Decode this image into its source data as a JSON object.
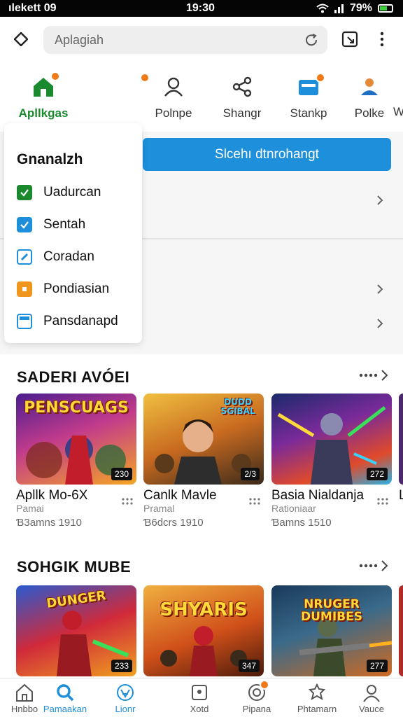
{
  "status_bar": {
    "carrier": "ılekett  09",
    "time": "19:30",
    "battery": "79%"
  },
  "search": {
    "placeholder": "Aplagiah"
  },
  "categories": [
    {
      "label": "Apllkgas",
      "icon": "home-icon"
    },
    {
      "label": "Polnpe",
      "icon": "person-icon"
    },
    {
      "label": "Shangr",
      "icon": "share-icon"
    },
    {
      "label": "Stankp",
      "icon": "screen-icon"
    },
    {
      "label": "Polke",
      "icon": "user-icon"
    },
    {
      "label": "W",
      "icon": "more-category"
    }
  ],
  "action_button": {
    "label": "Slcehı dtnrohangt"
  },
  "dropdown": {
    "title": "Gnanalzh",
    "items": [
      {
        "label": "Uadurcan",
        "icon": "checkbox-green-icon"
      },
      {
        "label": "Sentah",
        "icon": "checkbox-blue-icon"
      },
      {
        "label": "Coradan",
        "icon": "tag-icon"
      },
      {
        "label": "Pondiasian",
        "icon": "orange-box-icon"
      },
      {
        "label": "Pansdanapd",
        "icon": "store-icon"
      }
    ]
  },
  "sections": [
    {
      "title": "SADERI AVÓEI",
      "cards": [
        {
          "thumb_title": "PENSCUAGS",
          "count": "230",
          "name": "Apllk Mo-6X",
          "sub": "Pamai",
          "meta": "Ɓ3amns 1910"
        },
        {
          "thumb_title": "DUDD SGIBAL",
          "count": "2/3",
          "name": "Canlk Mavle",
          "sub": "Pramal",
          "meta": "Ɓ6dcrs 1910"
        },
        {
          "thumb_title": "",
          "count": "272",
          "name": "Basia Nialdanja",
          "sub": "Rationiaar",
          "meta": "Ɓamns 1510"
        },
        {
          "thumb_title": "",
          "count": "",
          "name": "L",
          "sub": "",
          "meta": ""
        }
      ]
    },
    {
      "title": "SOHGIK MUBE",
      "cards": [
        {
          "thumb_title": "DUNGER",
          "count": "233",
          "name": "",
          "sub": "",
          "meta": ""
        },
        {
          "thumb_title": "SHYARIS",
          "count": "347",
          "name": "",
          "sub": "",
          "meta": ""
        },
        {
          "thumb_title": "NRUGER DUMIBES",
          "count": "277",
          "name": "",
          "sub": "",
          "meta": ""
        }
      ]
    }
  ],
  "bottom_nav": [
    {
      "label": "Hnbbo",
      "icon": "home-icon"
    },
    {
      "label": "Pamaakan",
      "icon": "search-icon"
    },
    {
      "label": "Lionr",
      "icon": "lion-icon"
    },
    {
      "label": "Xotd",
      "icon": "picture-icon"
    },
    {
      "label": "Pipana",
      "icon": "target-icon"
    },
    {
      "label": "Phtamarn",
      "icon": "puzzle-icon"
    },
    {
      "label": "Vauce",
      "icon": "user-icon"
    }
  ],
  "colors": {
    "accent_blue": "#1e8fdb",
    "accent_green": "#1b8a2e",
    "badge_orange": "#f07a18"
  }
}
